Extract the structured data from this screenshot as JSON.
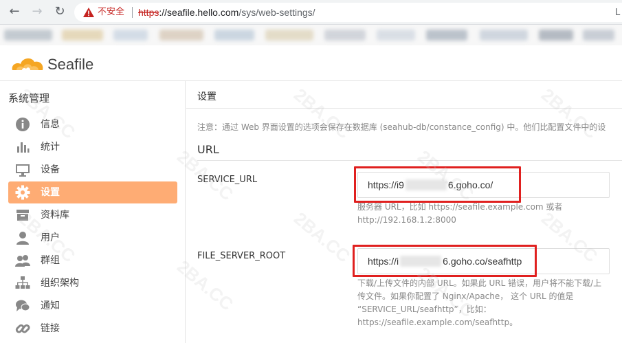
{
  "browser": {
    "insecure_label": "不安全",
    "url_scheme": "https",
    "url_host": "://seafile.hello.com",
    "url_path": "/sys/web-settings/",
    "corner_letter": "L"
  },
  "app": {
    "logo_text": "Seafile"
  },
  "sidebar": {
    "title": "系统管理",
    "items": [
      {
        "label": "信息",
        "icon": "info-icon"
      },
      {
        "label": "统计",
        "icon": "bar-chart-icon"
      },
      {
        "label": "设备",
        "icon": "monitor-icon"
      },
      {
        "label": "设置",
        "icon": "gear-icon",
        "active": true
      },
      {
        "label": "资料库",
        "icon": "archive-icon"
      },
      {
        "label": "用户",
        "icon": "user-icon"
      },
      {
        "label": "群组",
        "icon": "group-icon"
      },
      {
        "label": "组织架构",
        "icon": "org-chart-icon"
      },
      {
        "label": "通知",
        "icon": "chat-icon"
      },
      {
        "label": "链接",
        "icon": "link-icon"
      }
    ],
    "active_color": "#feac74"
  },
  "main": {
    "title": "设置",
    "tip": "注意：通过 Web 界面设置的选项会保存在数据库 (seahub-db/constance_config) 中。他们比配置文件中的设",
    "section": "URL",
    "fields": [
      {
        "label": "SERVICE_URL",
        "value_prefix": "https://i9",
        "value_suffix": "6.goho.co/",
        "help": "服务器 URL，比如 https://seafile.example.com 或者 http://192.168.1.2:8000"
      },
      {
        "label": "FILE_SERVER_ROOT",
        "value_prefix": "https://i",
        "value_suffix": "6.goho.co/seafhttp",
        "help": "下载/上传文件的内部 URL。如果此 URL 错误，用户将不能下载/上传文件。如果你配置了 Nginx/Apache， 这个 URL 的值是 “SERVICE_URL/seafhttp”，比如：https://seafile.example.com/seafhttp。"
      }
    ]
  },
  "watermark_text": "2BA.CC",
  "colors": {
    "highlight": "#e0201f",
    "insecure": "#c5221f"
  }
}
